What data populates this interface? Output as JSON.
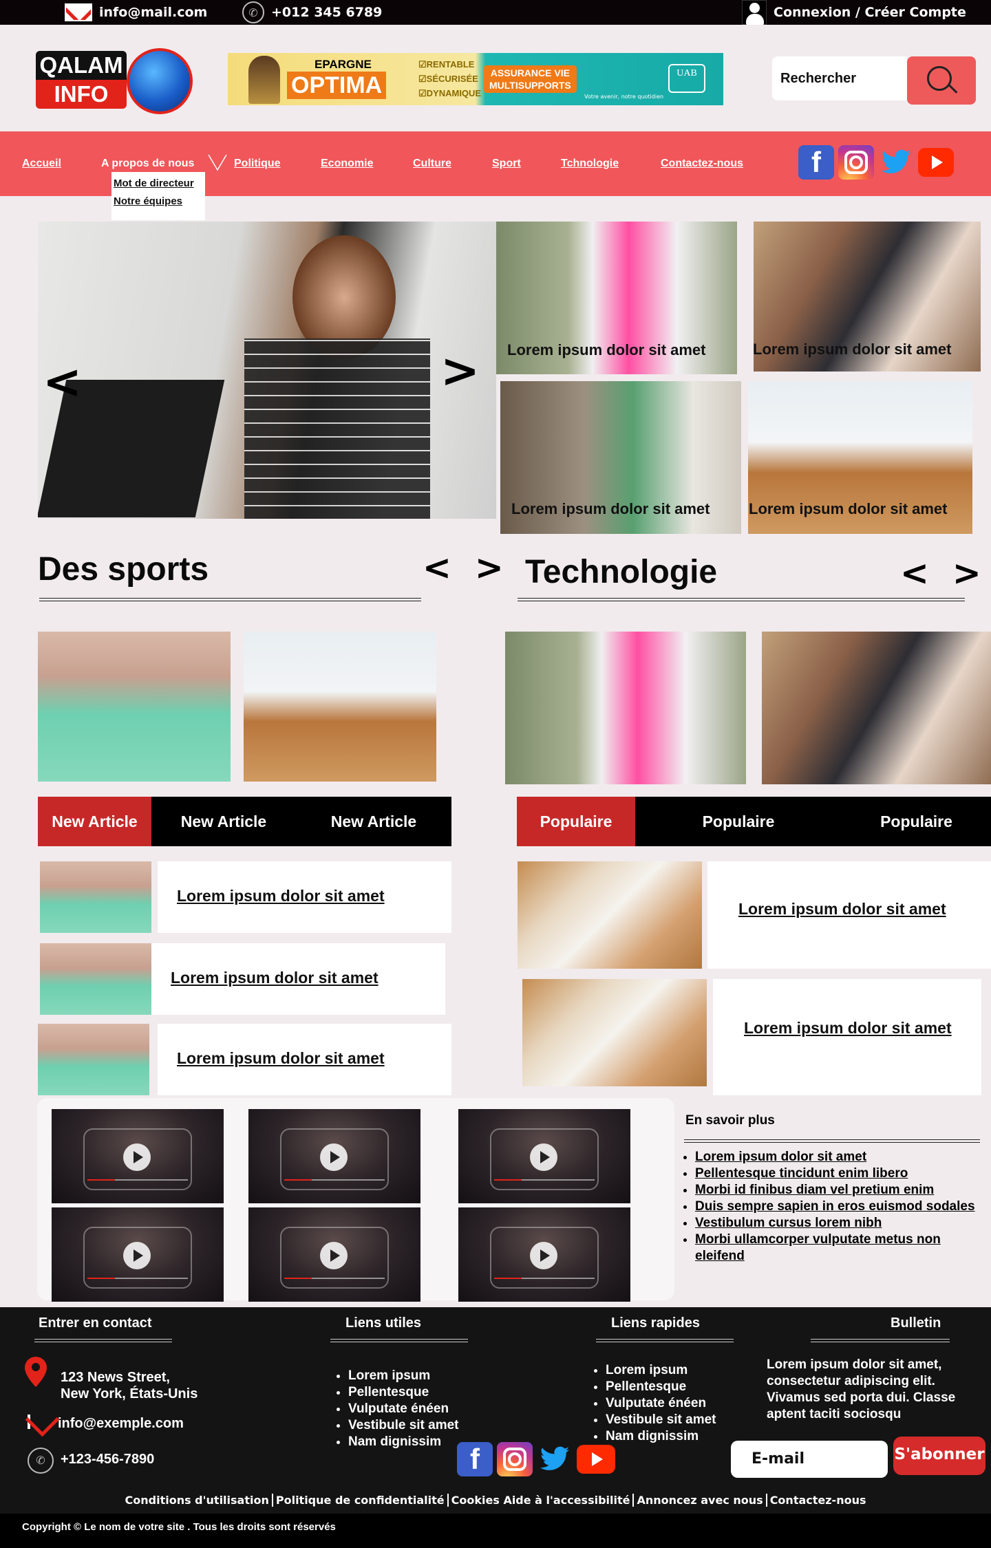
{
  "topbar": {
    "email": "info@mail.com",
    "phone": "+012 345 6789",
    "account": "Connexion / Créer Compte"
  },
  "logo": {
    "line1": "QALAM",
    "line2": "INFO"
  },
  "ad": {
    "brand": "EPARGNE",
    "product": "OPTIMA",
    "features": [
      "☑RENTABLE",
      "☑SÉCURISÉE",
      "☑DYNAMIQUE"
    ],
    "insurance_line1": "ASSURANCE VIE",
    "insurance_line2": "MULTISUPPORTS",
    "company": "UAB",
    "slogan": "Votre avenir, notre quotidien"
  },
  "search": {
    "placeholder": "Rechercher"
  },
  "nav": {
    "items": [
      "Accueil",
      "A propos de nous",
      "Politique",
      "Economie",
      "Culture",
      "Sport",
      "Tchnologie",
      "Contactez-nous"
    ],
    "dropdown": [
      "Mot de directeur",
      "Notre équipes"
    ]
  },
  "social": [
    "facebook-icon",
    "instagram-icon",
    "twitter-icon",
    "youtube-icon"
  ],
  "hero": {
    "prev": "<",
    "next": ">",
    "captions": [
      "Lorem ipsum dolor sit amet",
      "Lorem ipsum dolor sit amet",
      "Lorem ipsum dolor sit amet",
      "Lorem ipsum dolor sit amet"
    ]
  },
  "sports": {
    "title": "Des sports",
    "prev": "<",
    "next": ">"
  },
  "tech": {
    "title": "Technologie",
    "prev": "<",
    "next": ">"
  },
  "tabs_left": [
    "New Article",
    "New Article",
    "New Article"
  ],
  "tabs_right": [
    "Populaire",
    "Populaire",
    "Populaire"
  ],
  "articles_left": [
    "Lorem ipsum dolor sit amet",
    "Lorem ipsum dolor sit amet",
    "Lorem ipsum dolor sit amet"
  ],
  "articles_right": [
    "Lorem ipsum dolor sit amet",
    "Lorem ipsum dolor sit amet"
  ],
  "more": {
    "title": "En savoir plus",
    "items": [
      "Lorem ipsum dolor sit amet",
      "Pellentesque tincidunt enim libero",
      "Morbi id finibus diam vel pretium enim",
      "Duis sempre sapien in eros euismod sodales",
      "Vestibulum cursus lorem nibh",
      "Morbi ullamcorper vulputate metus non eleifend"
    ]
  },
  "footer": {
    "contact_title": "Entrer en contact",
    "address_line1": "123 News Street,",
    "address_line2": "New York, États-Unis",
    "email": "info@exemple.com",
    "phone": "+123-456-7890",
    "useful_title": "Liens utiles",
    "useful_links": [
      "Lorem ipsum",
      "Pellentesque",
      "Vulputate énéen",
      "Vestibule sit amet",
      "Nam dignissim"
    ],
    "quick_title": "Liens rapides",
    "quick_links": [
      "Lorem ipsum",
      "Pellentesque",
      "Vulputate énéen",
      "Vestibule sit amet",
      "Nam dignissim"
    ],
    "newsletter_title": "Bulletin",
    "newsletter_text": "Lorem ipsum dolor sit amet, consectetur adipiscing elit. Vivamus sed porta dui. Classe aptent taciti sociosqu",
    "email_placeholder": "E-mail",
    "subscribe": "S'abonner",
    "legal": [
      "Conditions  d'utilisation",
      "Politique de confidentialité",
      "Cookies  Aide à l'accessibilité",
      "Annoncez avec nous",
      "Contactez-nous"
    ],
    "copyright": "Copyright © Le nom de votre site . Tous les droits sont réservés"
  }
}
